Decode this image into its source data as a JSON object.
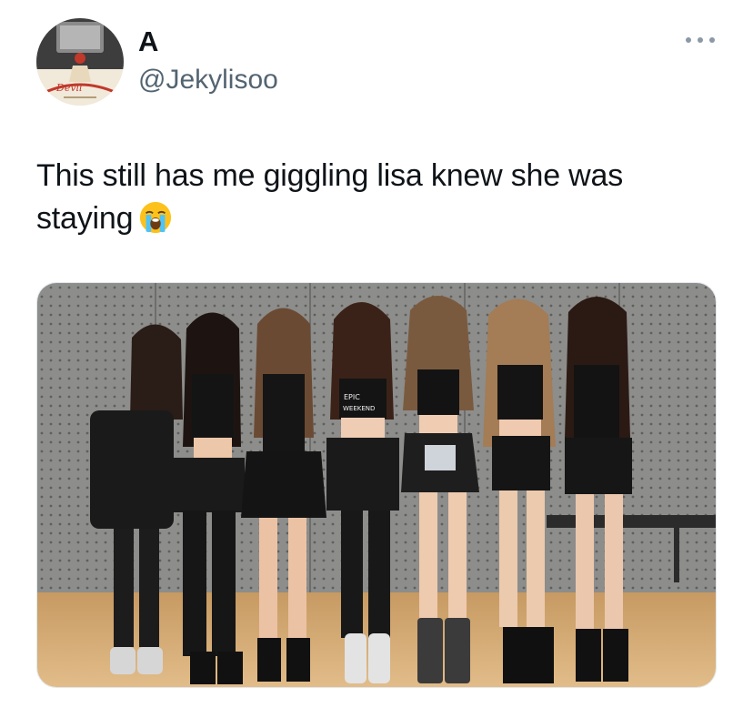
{
  "user": {
    "display_name": "A",
    "handle": "@Jekylisoo",
    "avatar_icon": "profile-photo"
  },
  "tweet": {
    "text_line1": "This still has me giggling lisa knew she was",
    "text_line2": "staying",
    "emoji": "loudly-crying-face-emoji"
  },
  "media": {
    "description_icon": "group-photo",
    "shirt_text": "EPIC WEEKEND"
  },
  "menu": {
    "icon": "more-options-icon"
  },
  "colors": {
    "text": "#0f1419",
    "secondary": "#536471",
    "dots": "#8b98a5"
  }
}
